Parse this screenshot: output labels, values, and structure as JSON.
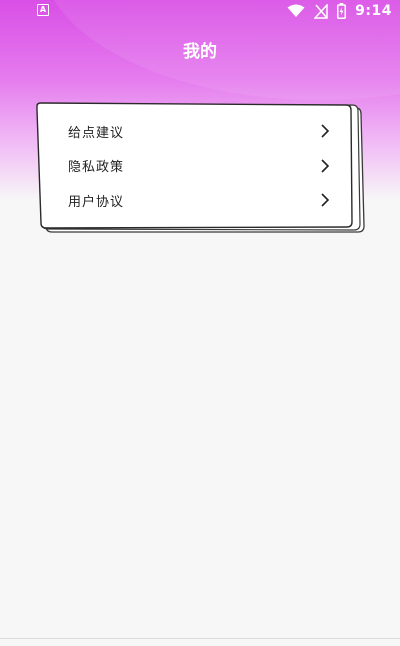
{
  "status_bar": {
    "app_icon_letter": "A",
    "time": "9:14"
  },
  "header": {
    "title": "我的"
  },
  "menu": {
    "items": [
      {
        "label": "给点建议",
        "icon": "chevron-right-icon"
      },
      {
        "label": "隐私政策",
        "icon": "chevron-right-icon"
      },
      {
        "label": "用户协议",
        "icon": "chevron-right-icon"
      }
    ]
  },
  "colors": {
    "header_gradient_top": "#d94fe6",
    "header_gradient_mid": "#e57cee",
    "background": "#f7f7f7",
    "card": "#ffffff",
    "text": "#222222"
  }
}
